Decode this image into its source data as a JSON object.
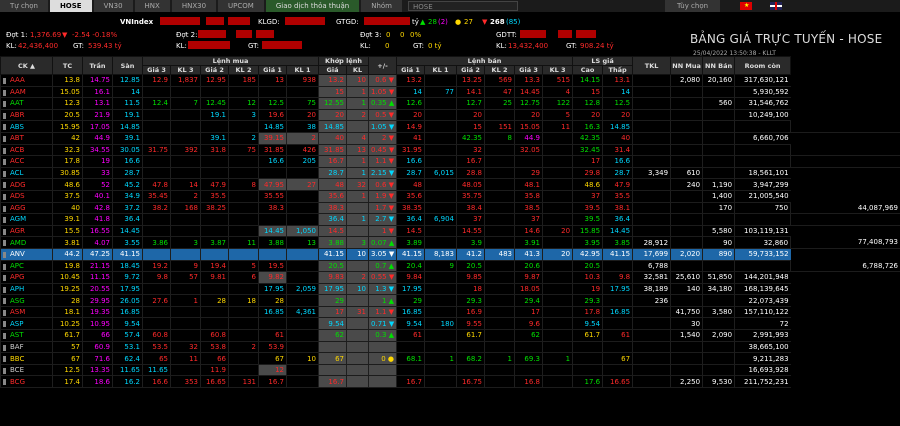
{
  "tabs": [
    "Tự chọn",
    "HOSE",
    "VN30",
    "HNX",
    "HNX30",
    "UPCOM",
    "Giao dịch thỏa thuận",
    "Nhóm"
  ],
  "group_select": "HOSE",
  "right_tab": "Tùy chọn",
  "index": {
    "vn_label": "VNIndex",
    "kl_label": "KLGD:",
    "gt_label": "GTGD:",
    "adv": "28",
    "adv_paren": "(2)",
    "unch": "27",
    "dec": "268",
    "dec_paren": "(85)",
    "gt_unit": "tỷ",
    "d1": "Đợt 1:",
    "d1v": "1,376.69",
    "d1c": "-2.54 -0.18%",
    "kl1": "KL:",
    "kl1v": "42,436,400",
    "gt1": "GT:",
    "gt1v": "539.43 tỷ",
    "d2": "Đợt 2:",
    "kl2": "KL:",
    "gt2": "GT:",
    "gt2v": "",
    "d3": "Đợt 3:",
    "d3v": "0",
    "d3c": "0%",
    "kl3": "KL:",
    "kl3v": "0",
    "gt3": "GT:",
    "gt3v": "0 tỷ",
    "gdtt": "GDTT:",
    "kl4": "KL:",
    "kl4v": "13,432,400",
    "gt4": "GT:",
    "gt4v": "908.24 tỷ"
  },
  "title": "BẢNG GIÁ TRỰC TUYẾN - HOSE",
  "timestamp": "25/04/2022 13:50:38 - KLLT",
  "colors": {
    "up": "#00e000",
    "down": "#ff2a2a",
    "ref": "#ffd800",
    "ceil": "#ff00ff",
    "floor": "#00d8ff",
    "highlight": "#1e67a8"
  },
  "headers": {
    "ck": "CK ▲",
    "tc": "TC",
    "tran": "Trần",
    "san": "Sàn",
    "lenh_mua": "Lệnh mua",
    "khop_lenh": "Khớp lệnh",
    "pm": "+/-",
    "lenh_ban": "Lệnh bán",
    "ls_gia": "LS giá",
    "tkl": "TKL",
    "nn_mua": "NN Mua",
    "nn_ban": "NN Bán",
    "room": "Room còn",
    "gia3": "Giá 3",
    "kl3": "KL 3",
    "gia2": "Giá 2",
    "kl2": "KL 2",
    "gia1": "Giá 1",
    "kl1": "KL 1",
    "gia": "Giá",
    "kl": "KL",
    "cao": "Cao",
    "thap": "Thấp"
  },
  "rows": [
    [
      "AAA",
      "13.8",
      "14.75",
      "12.85",
      "12.9",
      "1,837",
      "12.95",
      "185",
      "13",
      "938",
      "13.2",
      "10",
      "0.6",
      "13.2",
      "",
      "13.25",
      "569",
      "13.3",
      "515",
      "14.15",
      "13.1",
      "",
      "2,080",
      "20,160",
      "317,630,121"
    ],
    [
      "AAM",
      "15.05",
      "16.1",
      "14",
      "",
      "",
      "",
      "",
      "",
      "",
      "15",
      "1",
      "1.05",
      "14",
      "77",
      "14.1",
      "47",
      "14.45",
      "4",
      "15",
      "14",
      "",
      "",
      "",
      "5,930,592"
    ],
    [
      "AAT",
      "12.3",
      "13.1",
      "11.5",
      "12.4",
      "7",
      "12.45",
      "12",
      "12.5",
      "75",
      "12.55",
      "1",
      "0.35",
      "12.6",
      "",
      "12.7",
      "25",
      "12.75",
      "122",
      "12.8",
      "12.5",
      "",
      "",
      "560",
      "31,546,762"
    ],
    [
      "ABR",
      "20.5",
      "21.9",
      "19.1",
      "",
      "",
      "19.1",
      "3",
      "19.6",
      "20",
      "20",
      "2",
      "0.5",
      "20",
      "",
      "20",
      "",
      "20",
      "5",
      "20",
      "20",
      "",
      "",
      "",
      "10,249,100"
    ],
    [
      "ABS",
      "15.95",
      "17.05",
      "14.85",
      "",
      "",
      "",
      "",
      "14.85",
      "38",
      "14.85",
      "",
      "1.05",
      "14.9",
      "",
      "15",
      "151",
      "15.05",
      "11",
      "16.3",
      "14.85",
      "",
      "",
      "",
      "",
      ""
    ],
    [
      "ABT",
      "42",
      "44.9",
      "39.1",
      "",
      "",
      "39.1",
      "2",
      "39.15",
      "2",
      "40",
      "4",
      "2",
      "41",
      "",
      "42.35",
      "8",
      "44.9",
      "",
      "42.35",
      "40",
      "",
      "",
      "",
      "6,660,706"
    ],
    [
      "ACB",
      "32.3",
      "34.55",
      "30.05",
      "31.75",
      "392",
      "31.8",
      "75",
      "31.85",
      "426",
      "31.85",
      "13",
      "0.45",
      "31.95",
      "",
      "32",
      "",
      "32.05",
      "",
      "32.45",
      "31.4",
      "",
      "",
      "",
      "",
      ""
    ],
    [
      "ACC",
      "17.8",
      "19",
      "16.6",
      "",
      "",
      "",
      "",
      "16.6",
      "205",
      "16.7",
      "1",
      "1.1",
      "16.6",
      "",
      "16.7",
      "",
      "",
      "",
      "17",
      "16.6",
      "",
      "",
      "",
      "",
      ""
    ],
    [
      "ACL",
      "30.85",
      "33",
      "28.7",
      "",
      "",
      "",
      "",
      "",
      "",
      "28.7",
      "1",
      "2.15",
      "28.7",
      "6,015",
      "28.8",
      "",
      "29",
      "",
      "29.8",
      "28.7",
      "3,349",
      "610",
      "",
      "18,561,101"
    ],
    [
      "ADG",
      "48.6",
      "52",
      "45.2",
      "47.8",
      "14",
      "47.9",
      "8",
      "47.95",
      "27",
      "48",
      "32",
      "0.6",
      "48",
      "",
      "48.05",
      "",
      "48.1",
      "",
      "48.6",
      "47.9",
      "",
      "240",
      "1,190",
      "3,947,299"
    ],
    [
      "ADS",
      "37.5",
      "40.1",
      "34.9",
      "35.45",
      "2",
      "35.5",
      "",
      "35.55",
      "",
      "35.6",
      "1",
      "1.9",
      "35.6",
      "",
      "35.75",
      "",
      "35.8",
      "",
      "37",
      "35.5",
      "",
      "",
      "1,400",
      "21,005,540"
    ],
    [
      "AGG",
      "40",
      "42.8",
      "37.2",
      "38.2",
      "168",
      "38.25",
      "",
      "38.3",
      "",
      "38.3",
      "",
      "1.7",
      "38.35",
      "",
      "38.4",
      "",
      "38.5",
      "",
      "39.5",
      "38.1",
      "",
      "",
      "170",
      "750",
      "44,087,969"
    ],
    [
      "AGM",
      "39.1",
      "41.8",
      "36.4",
      "",
      "",
      "",
      "",
      "",
      "",
      "36.4",
      "1",
      "2.7",
      "36.4",
      "6,904",
      "37",
      "",
      "37",
      "",
      "39.5",
      "36.4",
      "",
      "",
      "",
      "",
      ""
    ],
    [
      "AGR",
      "15.5",
      "16.55",
      "14.45",
      "",
      "",
      "",
      "",
      "14.45",
      "1,050",
      "14.5",
      "",
      "1",
      "14.5",
      "",
      "14.55",
      "",
      "14.6",
      "20",
      "15.85",
      "14.45",
      "",
      "",
      "5,580",
      "103,119,131"
    ],
    [
      "AMD",
      "3.81",
      "4.07",
      "3.55",
      "3.86",
      "3",
      "3.87",
      "11",
      "3.88",
      "13",
      "3.88",
      "3",
      "0.07",
      "3.89",
      "",
      "3.9",
      "",
      "3.91",
      "",
      "3.95",
      "3.85",
      "28,912",
      "",
      "90",
      "32,860",
      "77,408,793"
    ],
    [
      "ANV",
      "44.2",
      "47.25",
      "41.15",
      "",
      "",
      "",
      "",
      "",
      "",
      "41.15",
      "10",
      "3.05",
      "41.15",
      "8,183",
      "41.2",
      "483",
      "41.3",
      "20",
      "42.95",
      "41.15",
      "17,699",
      "2,020",
      "890",
      "59,733,152"
    ],
    [
      "APC",
      "19.8",
      "21.15",
      "18.45",
      "19.2",
      "9",
      "19.4",
      "5",
      "19.5",
      "",
      "20.5",
      "",
      "0.7",
      "20.4",
      "9",
      "20.5",
      "",
      "20.6",
      "",
      "20.5",
      "",
      "6,788",
      "",
      "",
      "",
      "6,788,726"
    ],
    [
      "APG",
      "10.45",
      "11.15",
      "9.72",
      "9.8",
      "57",
      "9.81",
      "6",
      "9.82",
      "",
      "9.83",
      "2",
      "0.55",
      "9.84",
      "",
      "9.85",
      "",
      "9.87",
      "",
      "10.3",
      "9.8",
      "32,581",
      "25,610",
      "51,850",
      "144,201,948"
    ],
    [
      "APH",
      "19.25",
      "20.55",
      "17.95",
      "",
      "",
      "",
      "",
      "17.95",
      "2,059",
      "17.95",
      "10",
      "1.3",
      "17.95",
      "",
      "18",
      "",
      "18.05",
      "",
      "19",
      "17.95",
      "38,189",
      "140",
      "34,180",
      "168,139,645"
    ],
    [
      "ASG",
      "28",
      "29.95",
      "26.05",
      "27.6",
      "1",
      "28",
      "18",
      "28",
      "",
      "29",
      "",
      "1",
      "29",
      "",
      "29.3",
      "",
      "29.4",
      "",
      "29.3",
      "",
      "236",
      "",
      "",
      "22,073,439"
    ],
    [
      "ASM",
      "18.1",
      "19.35",
      "16.85",
      "",
      "",
      "",
      "",
      "16.85",
      "4,361",
      "17",
      "31",
      "1.1",
      "16.85",
      "",
      "16.9",
      "",
      "17",
      "",
      "17.8",
      "16.85",
      "",
      "41,750",
      "3,580",
      "157,110,122"
    ],
    [
      "ASP",
      "10.25",
      "10.95",
      "9.54",
      "",
      "",
      "",
      "",
      "",
      "",
      "9.54",
      "",
      "0.71",
      "9.54",
      "180",
      "9.55",
      "",
      "9.6",
      "",
      "9.54",
      "",
      "",
      "30",
      "",
      "72"
    ],
    [
      "AST",
      "61.7",
      "66",
      "57.4",
      "60.8",
      "",
      "60.8",
      "",
      "61",
      "",
      "62",
      "",
      "0.3",
      "61",
      "",
      "61.7",
      "",
      "62",
      "",
      "61.7",
      "61",
      "",
      "1,540",
      "2,090",
      "2,991,993"
    ],
    [
      "BAF",
      "57",
      "60.9",
      "53.1",
      "53.5",
      "32",
      "53.8",
      "2",
      "53.9",
      "",
      "",
      "",
      "",
      "",
      "",
      "",
      "",
      "",
      "",
      "",
      "",
      "",
      "",
      "",
      "38,665,100"
    ],
    [
      "BBC",
      "67",
      "71.6",
      "62.4",
      "65",
      "11",
      "66",
      "",
      "67",
      "10",
      "67",
      "",
      "0",
      "68.1",
      "1",
      "68.2",
      "1",
      "69.3",
      "1",
      "",
      "67",
      "",
      "",
      "",
      "9,211,283"
    ],
    [
      "BCE",
      "12.5",
      "13.35",
      "11.65",
      "11.65",
      "",
      "11.9",
      "",
      "12",
      "",
      "",
      "",
      "",
      "",
      "",
      "",
      "",
      "",
      "",
      "",
      "",
      "",
      "",
      "",
      "16,693,928"
    ],
    [
      "BCG",
      "17.4",
      "18.6",
      "16.2",
      "16.6",
      "353",
      "16.65",
      "131",
      "16.7",
      "",
      "16.7",
      "",
      "",
      "16.7",
      "",
      "16.75",
      "",
      "16.8",
      "",
      "17.6",
      "16.65",
      "",
      "2,250",
      "9,530",
      "211,752,231"
    ]
  ]
}
